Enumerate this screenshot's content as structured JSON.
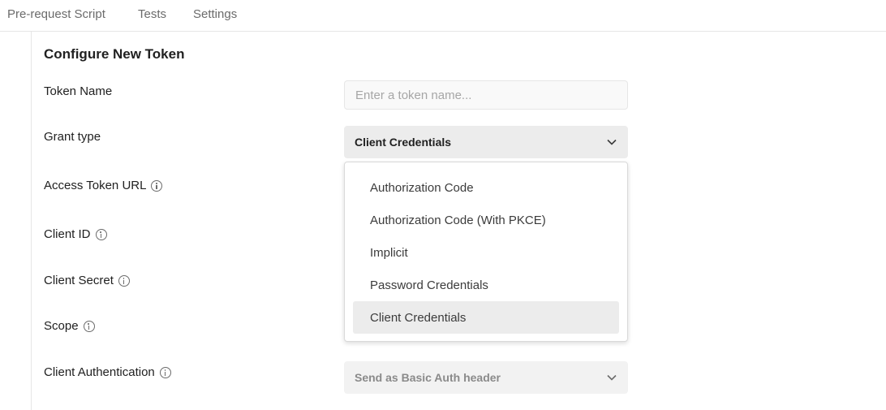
{
  "tabs": [
    "Pre-request Script",
    "Tests",
    "Settings"
  ],
  "form": {
    "title": "Configure New Token",
    "token_name_label": "Token Name",
    "token_name_placeholder": "Enter a token name...",
    "grant_type_label": "Grant type",
    "grant_type_value": "Client Credentials",
    "access_token_url_label": "Access Token URL",
    "client_id_label": "Client ID",
    "client_secret_label": "Client Secret",
    "scope_label": "Scope",
    "client_auth_label": "Client Authentication",
    "client_auth_value": "Send as Basic Auth header"
  },
  "grant_type_options": [
    "Authorization Code",
    "Authorization Code (With PKCE)",
    "Implicit",
    "Password Credentials",
    "Client Credentials"
  ],
  "selected_option_index": 4,
  "icons": {
    "info": "info-icon",
    "chevron": "chevron-down-icon"
  },
  "colors": {
    "text": "#212121",
    "muted_text": "#6b6b6b",
    "select_bg": "#ececec",
    "border": "#e6e6e6"
  }
}
